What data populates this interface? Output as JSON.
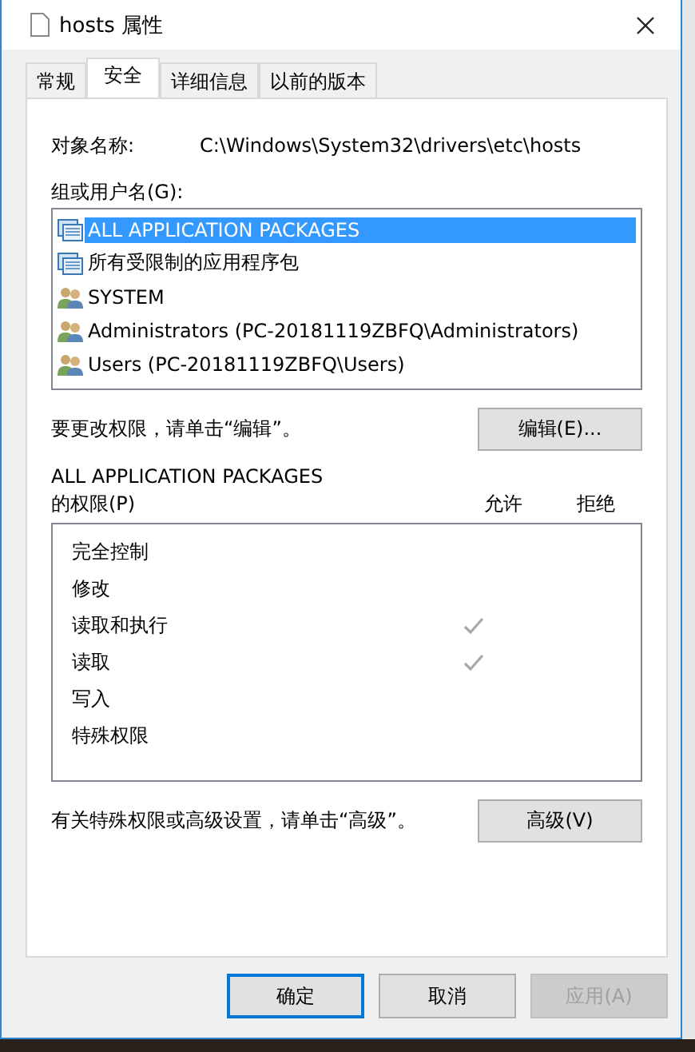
{
  "window": {
    "title": "hosts 属性"
  },
  "tabs": [
    {
      "label": "常规",
      "selected": false
    },
    {
      "label": "安全",
      "selected": true
    },
    {
      "label": "详细信息",
      "selected": false
    },
    {
      "label": "以前的版本",
      "selected": false
    }
  ],
  "object": {
    "label": "对象名称:",
    "value": "C:\\Windows\\System32\\drivers\\etc\\hosts"
  },
  "principals": {
    "label": "组或用户名(G):",
    "items": [
      {
        "kind": "package",
        "name": "ALL APPLICATION PACKAGES",
        "selected": true
      },
      {
        "kind": "package",
        "name": "所有受限制的应用程序包",
        "selected": false
      },
      {
        "kind": "group",
        "name": "SYSTEM",
        "selected": false
      },
      {
        "kind": "group",
        "name": "Administrators (PC-20181119ZBFQ\\Administrators)",
        "selected": false
      },
      {
        "kind": "group",
        "name": "Users (PC-20181119ZBFQ\\Users)",
        "selected": false
      }
    ]
  },
  "edit_hint": "要更改权限，请单击“编辑”。",
  "edit_button": "编辑(E)...",
  "permissions": {
    "title_line1": "ALL APPLICATION PACKAGES",
    "title_line2": "的权限(P)",
    "allow_header": "允许",
    "deny_header": "拒绝",
    "rows": [
      {
        "name": "完全控制",
        "allow": false,
        "deny": false
      },
      {
        "name": "修改",
        "allow": false,
        "deny": false
      },
      {
        "name": "读取和执行",
        "allow": true,
        "deny": false
      },
      {
        "name": "读取",
        "allow": true,
        "deny": false
      },
      {
        "name": "写入",
        "allow": false,
        "deny": false
      },
      {
        "name": "特殊权限",
        "allow": false,
        "deny": false
      }
    ]
  },
  "advanced_hint": "有关特殊权限或高级设置，请单击“高级”。",
  "advanced_button": "高级(V)",
  "buttons": [
    {
      "label": "确定",
      "default": true,
      "disabled": false
    },
    {
      "label": "取消",
      "default": false,
      "disabled": false
    },
    {
      "label": "应用(A)",
      "default": false,
      "disabled": true
    }
  ]
}
